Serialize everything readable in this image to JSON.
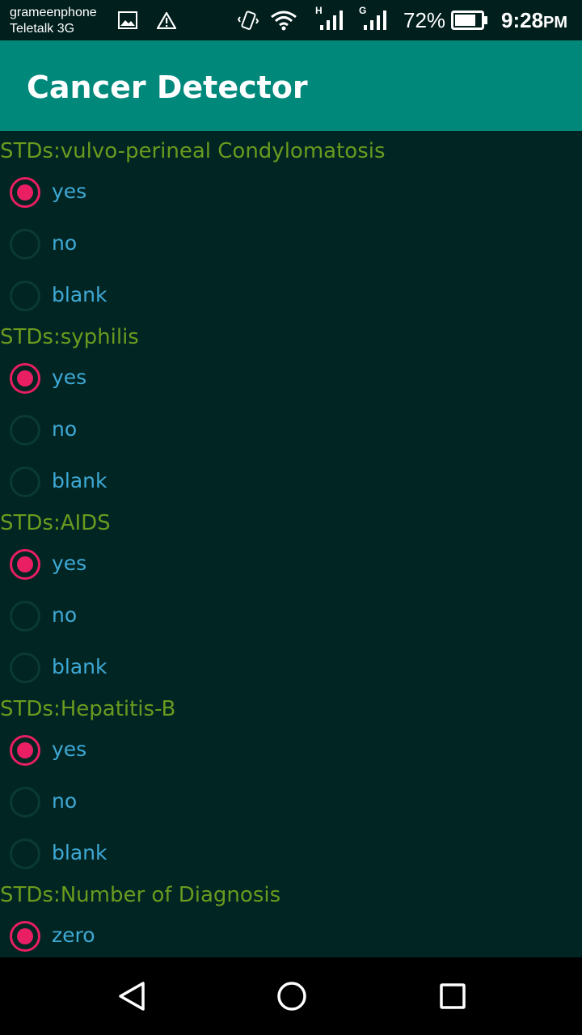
{
  "status_bar": {
    "carrier_primary": "grameenphone",
    "carrier_secondary": "Teletalk 3G",
    "battery_percent": "72%",
    "time": "9:28",
    "time_suffix": "PM",
    "network_1_label": "H",
    "network_2_label": "G"
  },
  "app_bar": {
    "title": "Cancer Detector"
  },
  "questions": [
    {
      "label": "STDs:vulvo-perineal Condylomatosis",
      "options": [
        "yes",
        "no",
        "blank"
      ],
      "selected": "yes"
    },
    {
      "label": "STDs:syphilis",
      "options": [
        "yes",
        "no",
        "blank"
      ],
      "selected": "yes"
    },
    {
      "label": "STDs:AIDS",
      "options": [
        "yes",
        "no",
        "blank"
      ],
      "selected": "yes"
    },
    {
      "label": "STDs:Hepatitis-B",
      "options": [
        "yes",
        "no",
        "blank"
      ],
      "selected": "yes"
    },
    {
      "label": "STDs:Number of Diagnosis",
      "options": [
        "zero"
      ],
      "selected": "zero"
    }
  ],
  "colors": {
    "app_bar": "#00897b",
    "background": "#002522",
    "question_label": "#6a9a1f",
    "option_label": "#3fa9d6",
    "radio_checked": "#e91e63"
  },
  "icons": {
    "status": [
      "gallery-icon",
      "warning-icon",
      "vibrate-icon",
      "wifi-icon",
      "signal-icon",
      "battery-icon"
    ],
    "nav": [
      "back-icon",
      "home-icon",
      "recents-icon"
    ]
  }
}
